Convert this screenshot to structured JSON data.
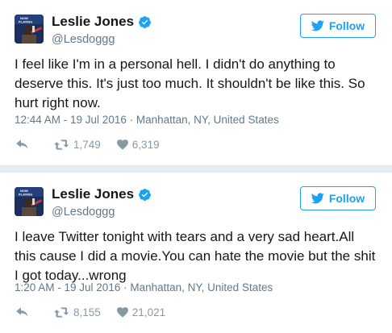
{
  "colors": {
    "accent": "#1da1f2",
    "muted": "#657786",
    "icon": "#8899a6"
  },
  "avatar_badge": "NOW PLAYING",
  "tweets": [
    {
      "author": {
        "name": "Leslie Jones",
        "handle": "@Lesdoggg",
        "verified": true
      },
      "follow_label": "Follow",
      "text": "I feel like I'm in a personal hell. I didn't do anything to deserve this. It's just too much. It shouldn't be like this. So hurt right now.",
      "timestamp": "12:44 AM - 19 Jul 2016",
      "location": "Manhattan, NY, United States",
      "retweets": "1,749",
      "likes": "6,319",
      "icons": [
        "reply-icon",
        "retweet-icon",
        "heart-icon"
      ]
    },
    {
      "author": {
        "name": "Leslie Jones",
        "handle": "@Lesdoggg",
        "verified": true
      },
      "follow_label": "Follow",
      "text": "I leave Twitter tonight with tears and a very sad heart.All this cause I did a movie.You can hate the movie but the shit I got today...wrong",
      "timestamp": "1:20 AM - 19 Jul 2016",
      "location": "Manhattan, NY, United States",
      "retweets": "8,155",
      "likes": "21,021",
      "icons": [
        "reply-icon",
        "retweet-icon",
        "heart-icon"
      ]
    }
  ]
}
